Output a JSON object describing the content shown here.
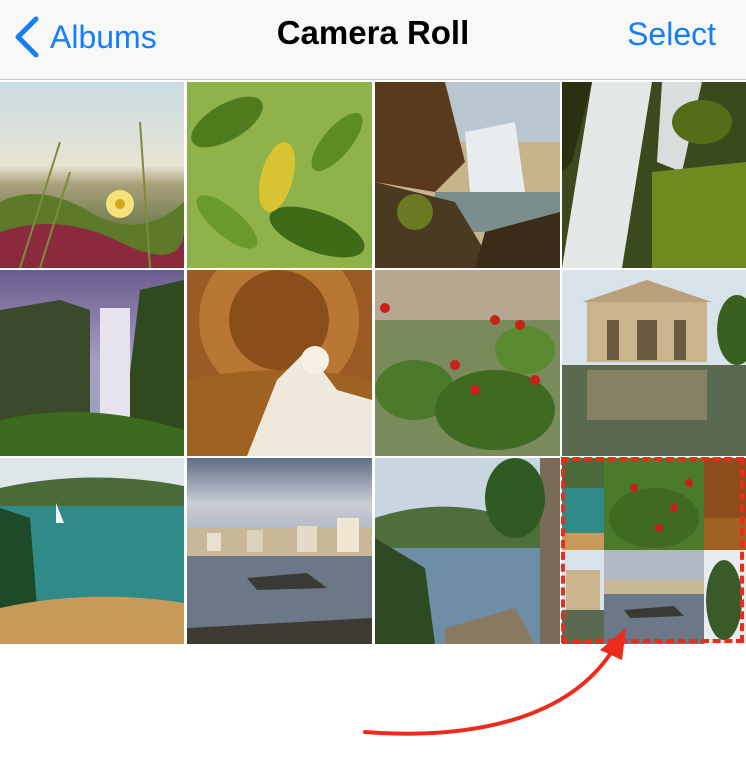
{
  "navbar": {
    "back_label": "Albums",
    "title": "Camera Roll",
    "select_label": "Select"
  },
  "colors": {
    "accent": "#147efb",
    "annotation": "#ee2a1a"
  },
  "photos": [
    {
      "name": "photo-dune-flower",
      "subject": "ice plant flower on sand dune"
    },
    {
      "name": "photo-lemon-leaves",
      "subject": "green leaves with yellow leaf"
    },
    {
      "name": "photo-waterfall-sunset",
      "subject": "waterfall with rocks"
    },
    {
      "name": "photo-mossy-falls",
      "subject": "mossy waterfall long exposure"
    },
    {
      "name": "photo-skogafoss",
      "subject": "tall waterfall with purple sky"
    },
    {
      "name": "photo-dome-statue",
      "subject": "coffered dome with marble statue"
    },
    {
      "name": "photo-red-berries",
      "subject": "plant with red berries"
    },
    {
      "name": "photo-pavilion-pond",
      "subject": "pavilion reflected in pond"
    },
    {
      "name": "photo-sailboat-bay",
      "subject": "sailboat in turquoise bay"
    },
    {
      "name": "photo-coastal-village",
      "subject": "coastal village at dusk"
    },
    {
      "name": "photo-cliff-coast",
      "subject": "coastline with pine tree"
    }
  ],
  "annotation": {
    "drag_target": "selection preview",
    "arrow": "curved-arrow-pointing-up-left"
  }
}
